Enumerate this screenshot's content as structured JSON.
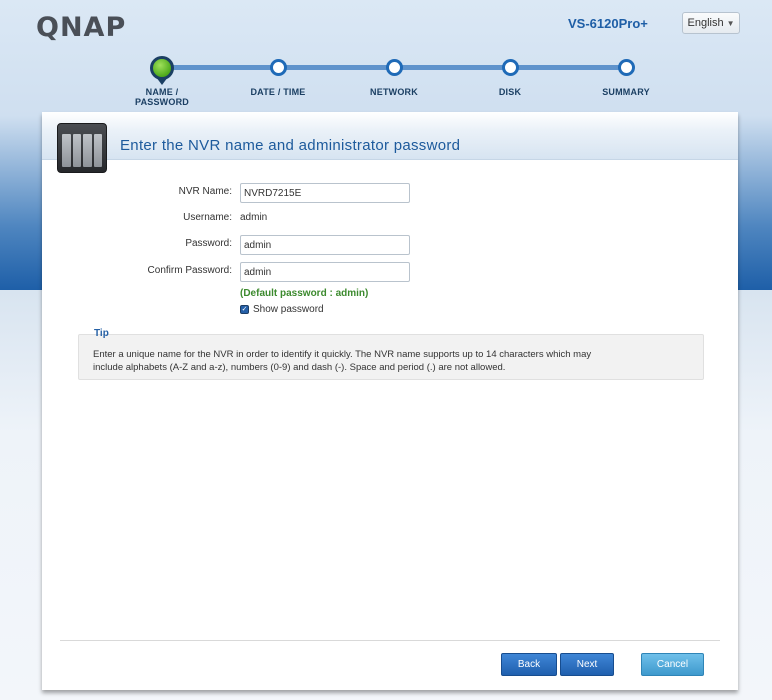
{
  "header": {
    "logo": "QNAP",
    "model": "VS-6120Pro+",
    "language": "English"
  },
  "steps": [
    {
      "label": "NAME / PASSWORD",
      "line1": "NAME /",
      "line2": "PASSWORD",
      "active": true
    },
    {
      "label": "DATE / TIME",
      "active": false
    },
    {
      "label": "NETWORK",
      "active": false
    },
    {
      "label": "DISK",
      "active": false
    },
    {
      "label": "SUMMARY",
      "active": false
    }
  ],
  "panel": {
    "title": "Enter the NVR name and administrator password"
  },
  "form": {
    "nvr_name_label": "NVR Name:",
    "nvr_name_value": "NVRD7215E",
    "username_label": "Username:",
    "username_value": "admin",
    "password_label": "Password:",
    "password_value": "admin",
    "confirm_label": "Confirm Password:",
    "confirm_value": "admin",
    "default_note": "(Default password : admin)",
    "show_password_label": "Show password",
    "show_password_checked": true
  },
  "tip": {
    "heading": "Tip",
    "line1": "Enter a unique name for the NVR in order to identify it quickly. The NVR name supports up to 14 characters which may",
    "line2": "include alphabets (A-Z and a-z), numbers (0-9) and dash (-). Space and period (.) are not allowed."
  },
  "buttons": {
    "back": "Back",
    "next": "Next",
    "cancel": "Cancel"
  },
  "colors": {
    "brand_blue": "#1e5ea6",
    "step_active": "#4faa1c",
    "note_green": "#3c8a2e"
  }
}
